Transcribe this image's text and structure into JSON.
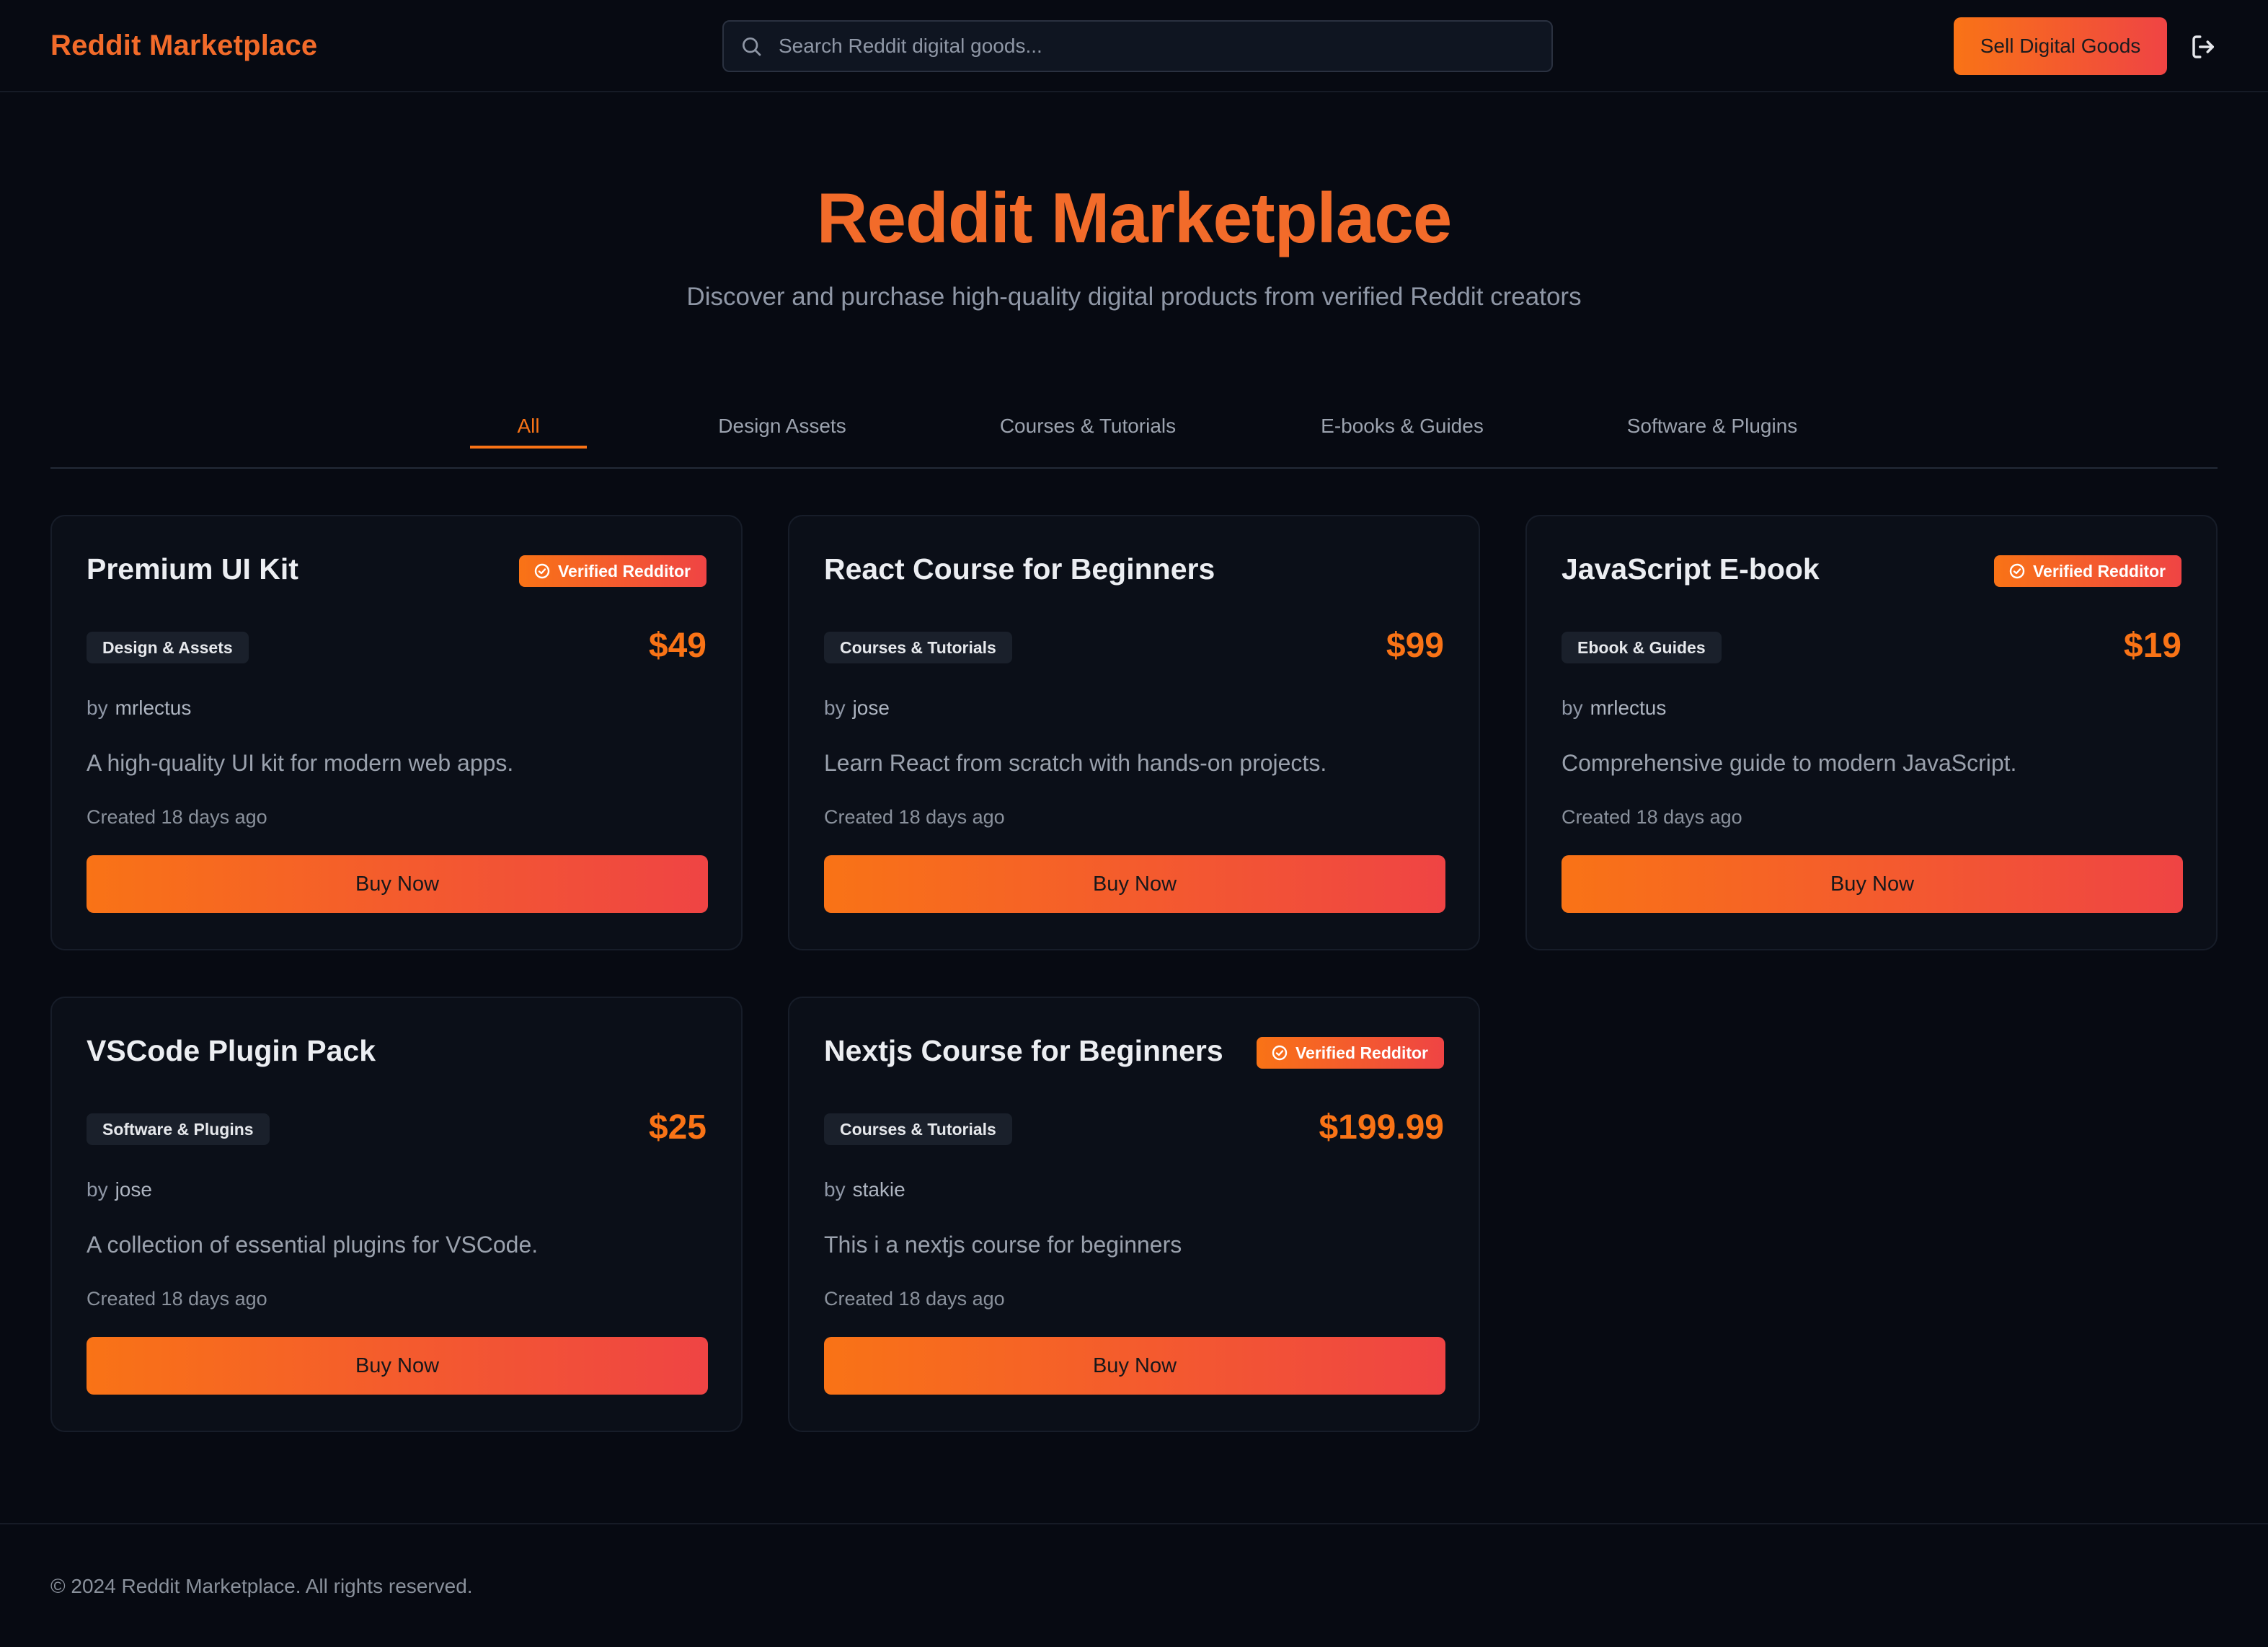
{
  "header": {
    "brand": "Reddit Marketplace",
    "search_placeholder": "Search Reddit digital goods...",
    "sell_label": "Sell Digital Goods",
    "logout_icon": "logout-icon"
  },
  "hero": {
    "title": "Reddit Marketplace",
    "subtitle": "Discover and purchase high-quality digital products from verified Reddit creators"
  },
  "tabs": [
    {
      "label": "All",
      "active": true
    },
    {
      "label": "Design Assets",
      "active": false
    },
    {
      "label": "Courses & Tutorials",
      "active": false
    },
    {
      "label": "E-books & Guides",
      "active": false
    },
    {
      "label": "Software & Plugins",
      "active": false
    }
  ],
  "products": [
    {
      "title": "Premium UI Kit",
      "verified_label": "Verified Redditor",
      "category": "Design & Assets",
      "price": "$49",
      "by_label": "by",
      "author": "mrlectus",
      "description": "A high-quality UI kit for modern web apps.",
      "created": "Created 18 days ago",
      "buy_label": "Buy Now"
    },
    {
      "title": "React Course for Beginners",
      "verified_label": "",
      "category": "Courses & Tutorials",
      "price": "$99",
      "by_label": "by",
      "author": "jose",
      "description": "Learn React from scratch with hands-on projects.",
      "created": "Created 18 days ago",
      "buy_label": "Buy Now"
    },
    {
      "title": "JavaScript E-book",
      "verified_label": "Verified Redditor",
      "category": "Ebook & Guides",
      "price": "$19",
      "by_label": "by",
      "author": "mrlectus",
      "description": "Comprehensive guide to modern JavaScript.",
      "created": "Created 18 days ago",
      "buy_label": "Buy Now"
    },
    {
      "title": "VSCode Plugin Pack",
      "verified_label": "",
      "category": "Software & Plugins",
      "price": "$25",
      "by_label": "by",
      "author": "jose",
      "description": "A collection of essential plugins for VSCode.",
      "created": "Created 18 days ago",
      "buy_label": "Buy Now"
    },
    {
      "title": "Nextjs Course for Beginners",
      "verified_label": "Verified Redditor",
      "category": "Courses & Tutorials",
      "price": "$199.99",
      "by_label": "by",
      "author": "stakie",
      "description": "This i a nextjs course for beginners",
      "created": "Created 18 days ago",
      "buy_label": "Buy Now"
    }
  ],
  "footer": {
    "text": "© 2024 Reddit Marketplace. All rights reserved."
  },
  "colors": {
    "accent": "#f97316",
    "accent_end": "#ef4444",
    "background": "#070a12",
    "card": "#0b0f18"
  }
}
